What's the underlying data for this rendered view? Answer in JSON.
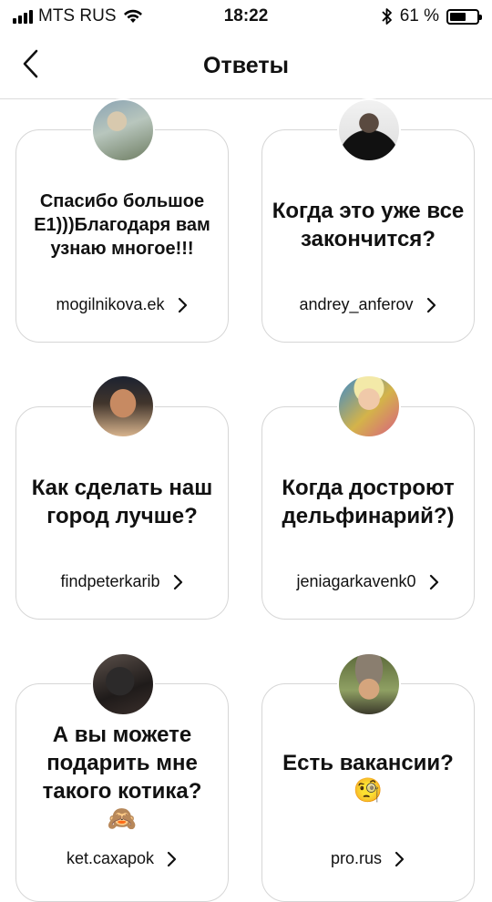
{
  "status_bar": {
    "carrier": "MTS RUS",
    "time": "18:22",
    "battery_percent": "61 %",
    "battery_level": 0.61
  },
  "header": {
    "title": "Ответы"
  },
  "cards": [
    {
      "question": "Спасибо большое Е1)))Благодаря вам узнаю многое!!!",
      "username": "mogilnikova.ek"
    },
    {
      "question": "Когда это уже все закончится?",
      "username": "andrey_anferov"
    },
    {
      "question": "Как сделать наш город лучше?",
      "username": "findpeterkarib"
    },
    {
      "question": "Когда достроют дельфинарий?)",
      "username": "jeniagarkavenk0"
    },
    {
      "question": "А вы можете подарить мне такого котика?",
      "emoji": "🙈",
      "username": "ket.caxapok"
    },
    {
      "question": "Есть вакансии?",
      "emoji": "🧐",
      "username": "pro.rus"
    }
  ],
  "icons": {
    "back": "chevron-left-icon",
    "user_chevron": "chevron-right-icon",
    "bluetooth": "bluetooth-icon",
    "wifi": "wifi-icon"
  }
}
